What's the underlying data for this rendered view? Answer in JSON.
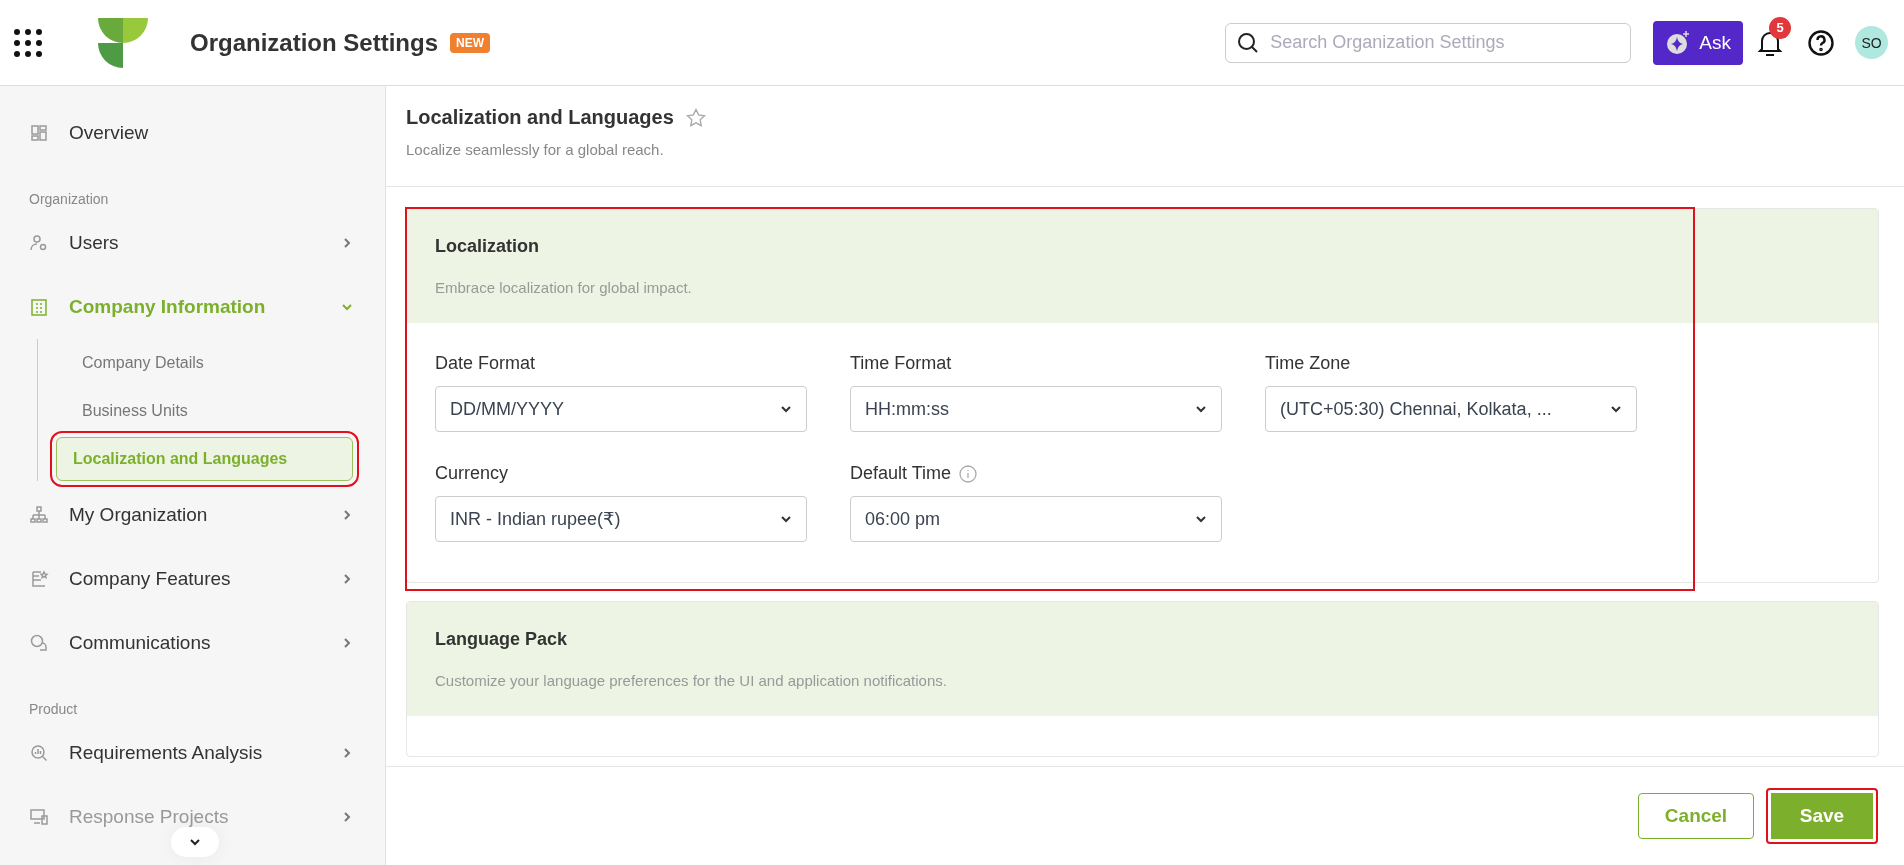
{
  "header": {
    "title": "Organization Settings",
    "badge": "NEW",
    "search": {
      "placeholder": "Search Organization Settings"
    },
    "ask_button": "Ask",
    "notifications": "5",
    "avatar": "SO"
  },
  "sidebar": {
    "items": [
      {
        "kind": "item",
        "label": "Overview",
        "selected": false,
        "disabled": false
      },
      {
        "kind": "section",
        "label": "Organization"
      },
      {
        "kind": "item",
        "label": "Users",
        "selected": false,
        "expanded": false,
        "disabled": false
      },
      {
        "kind": "item",
        "label": "Company Information",
        "selected": true,
        "expanded": true,
        "disabled": false,
        "children": [
          {
            "label": "Company Details",
            "selected": false,
            "highlighted": false
          },
          {
            "label": "Business Units",
            "selected": false,
            "highlighted": false
          },
          {
            "label": "Localization and Languages",
            "selected": true,
            "highlighted": true
          }
        ]
      },
      {
        "kind": "item",
        "label": "My Organization",
        "selected": false,
        "expanded": false,
        "disabled": false
      },
      {
        "kind": "item",
        "label": "Company Features",
        "selected": false,
        "expanded": false,
        "disabled": false
      },
      {
        "kind": "item",
        "label": "Communications",
        "selected": false,
        "expanded": false,
        "disabled": false
      },
      {
        "kind": "section",
        "label": "Product"
      },
      {
        "kind": "item",
        "label": "Requirements Analysis",
        "selected": false,
        "expanded": false,
        "disabled": false
      },
      {
        "kind": "item",
        "label": "Response Projects",
        "selected": false,
        "expanded": false,
        "disabled": true
      }
    ]
  },
  "page": {
    "title": "Localization and Languages",
    "subtitle": "Localize seamlessly for a global reach."
  },
  "cards": [
    {
      "title": "Localization",
      "subtitle": "Embrace localization for global impact.",
      "highlighted": true,
      "fields": [
        {
          "label": "Date Format",
          "value": "DD/MM/YYYY",
          "info": false
        },
        {
          "label": "Time Format",
          "value": "HH:mm:ss",
          "info": false
        },
        {
          "label": "Time Zone",
          "value": "(UTC+05:30) Chennai, Kolkata, ...",
          "info": false
        },
        {
          "label": "Currency",
          "value": "INR - Indian rupee(₹)",
          "info": false
        },
        {
          "label": "Default Time",
          "value": "06:00 pm",
          "info": true
        }
      ]
    },
    {
      "title": "Language Pack",
      "subtitle": "Customize your language preferences for the UI and application notifications.",
      "highlighted": false
    }
  ],
  "footer": {
    "cancel": {
      "label": "Cancel",
      "highlighted": false
    },
    "save": {
      "label": "Save",
      "highlighted": true
    }
  }
}
